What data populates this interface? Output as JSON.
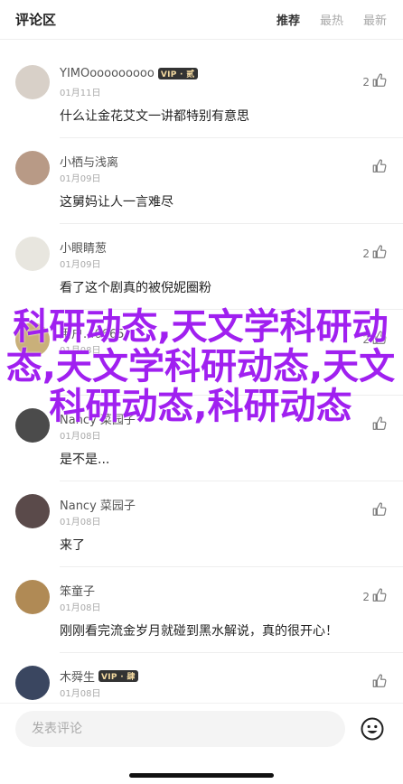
{
  "header": {
    "title": "评论区",
    "tabs": [
      {
        "label": "推荐",
        "active": true
      },
      {
        "label": "最热",
        "active": false
      },
      {
        "label": "最新",
        "active": false
      }
    ]
  },
  "comments": [
    {
      "name": "YIMOooooooooo",
      "badge": "VIP · 贰",
      "date": "01月11日",
      "text": "什么让金花艾文一讲都特别有意思",
      "likes": "2",
      "avatar_color": "#d8d0c8",
      "avatar_icon": "person-photo-icon"
    },
    {
      "name": "小栖与浅离",
      "badge": "",
      "date": "01月09日",
      "text": "这舅妈让人一言难尽",
      "likes": "",
      "avatar_color": "#b89a86",
      "avatar_icon": "person-photo-icon"
    },
    {
      "name": "小眼睛葱",
      "badge": "",
      "date": "01月09日",
      "text": "看了这个剧真的被倪妮圈粉",
      "likes": "2",
      "avatar_color": "#e8e6df",
      "avatar_icon": "cartoon-bear-icon"
    },
    {
      "name": "用户...6665",
      "badge": "",
      "date": "01月08日",
      "text": "",
      "likes": "2",
      "avatar_color": "#c9b07a",
      "avatar_icon": "person-photo-icon"
    },
    {
      "name": "Nancy 菜园子",
      "badge": "",
      "date": "01月08日",
      "text": "是不是...",
      "likes": "",
      "avatar_color": "#4b4b4b",
      "avatar_icon": "person-photo-icon"
    },
    {
      "name": "Nancy 菜园子",
      "badge": "",
      "date": "01月08日",
      "text": "来了",
      "likes": "",
      "avatar_color": "#5a4a4a",
      "avatar_icon": "person-photo-icon"
    },
    {
      "name": "笨童子",
      "badge": "",
      "date": "01月08日",
      "text": "刚刚看完流金岁月就碰到黑水解说，真的很开心！",
      "likes": "2",
      "avatar_color": "#b08a55",
      "avatar_icon": "person-photo-icon"
    },
    {
      "name": "木舜生",
      "badge": "VIP · 肆",
      "date": "01月08日",
      "text": "",
      "likes": "",
      "avatar_color": "#3a4660",
      "avatar_icon": "person-photo-icon"
    }
  ],
  "watermark": "科研动态,天文学科研动态,天文学科研动态,天文科研动态,科研动态",
  "footer": {
    "placeholder": "发表评论"
  }
}
